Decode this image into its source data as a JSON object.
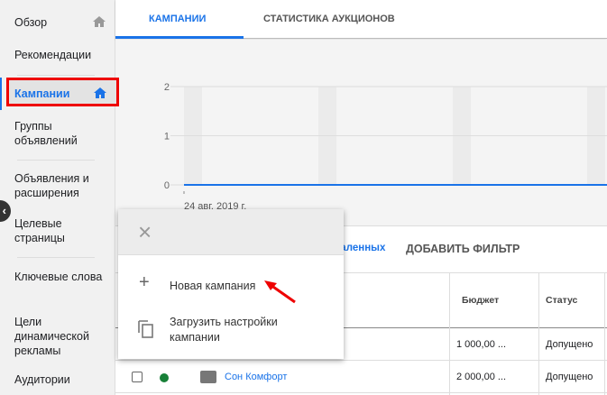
{
  "sidebar": {
    "items": [
      {
        "label": "Обзор"
      },
      {
        "label": "Рекомендации"
      },
      {
        "label": "Кампании"
      },
      {
        "label": "Группы объявлений"
      },
      {
        "label": "Объявления и расширения"
      },
      {
        "label": "Целевые страницы"
      },
      {
        "label": "Ключевые слова"
      },
      {
        "label": "Цели динамической рекламы"
      },
      {
        "label": "Аудитории"
      }
    ],
    "collapse": "‹"
  },
  "tabs": [
    {
      "label": "КАМПАНИИ"
    },
    {
      "label": "СТАТИСТИКА АУКЦИОНОВ"
    }
  ],
  "chart_data": {
    "type": "line",
    "y_ticks": [
      "2",
      "1",
      "0"
    ],
    "ylim": [
      0,
      2
    ],
    "x_start_label": "24 авг. 2019 г.",
    "series": [
      {
        "name": "campaigns",
        "values": [
          0,
          0,
          0,
          0,
          0,
          0,
          0,
          0,
          0,
          0,
          0,
          0,
          0,
          0,
          0,
          0,
          0,
          0,
          0,
          0,
          0,
          0,
          0
        ]
      }
    ],
    "color": "#1a73e8"
  },
  "filter": {
    "removed_link": "даленных",
    "add_filter": "ДОБАВИТЬ ФИЛЬТР"
  },
  "table": {
    "headers": {
      "budget": "Бюджет",
      "status": "Статус"
    },
    "rows": [
      {
        "name": "",
        "budget": "1 000,00 ...",
        "status": "Допущено"
      },
      {
        "name": "Сон Комфорт",
        "budget": "2 000,00 ...",
        "status": "Допущено"
      }
    ]
  },
  "popup": {
    "close": "×",
    "new_campaign": "Новая кампания",
    "load_settings": "Загрузить настройки кампании"
  }
}
